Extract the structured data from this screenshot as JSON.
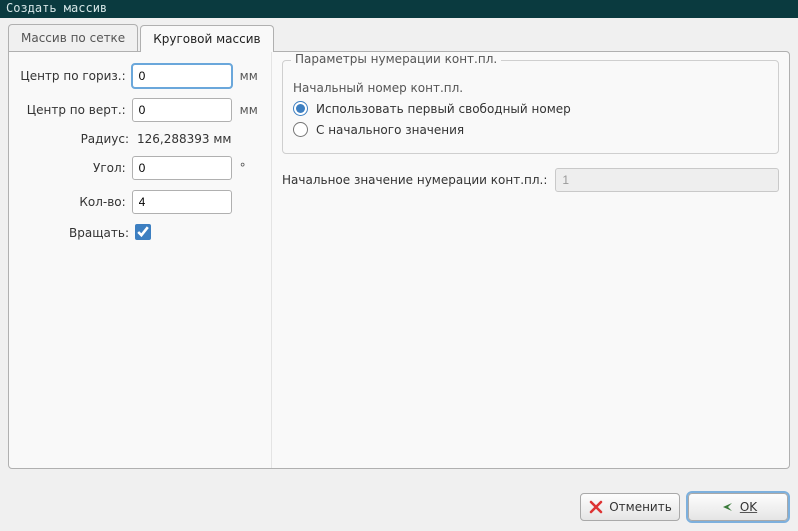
{
  "window": {
    "title": "Создать массив"
  },
  "tabs": {
    "grid": "Массив по сетке",
    "circular": "Круговой массив"
  },
  "form": {
    "center_h": {
      "label": "Центр по гориз.:",
      "value": "0",
      "unit": "мм"
    },
    "center_v": {
      "label": "Центр по верт.:",
      "value": "0",
      "unit": "мм"
    },
    "radius": {
      "label": "Радиус:",
      "text": "126,288393 мм"
    },
    "angle": {
      "label": "Угол:",
      "value": "0",
      "unit": "°"
    },
    "count": {
      "label": "Кол-во:",
      "value": "4"
    },
    "rotate": {
      "label": "Вращать:"
    }
  },
  "numbering": {
    "group_title": "Параметры нумерации конт.пл.",
    "initial_title": "Начальный номер конт.пл.",
    "opt_first_free": "Использовать первый свободный номер",
    "opt_from_start": "С начального значения",
    "start_label": "Начальное значение нумерации конт.пл.:",
    "start_value": "1"
  },
  "buttons": {
    "cancel": "Отменить",
    "ok": "OK"
  }
}
